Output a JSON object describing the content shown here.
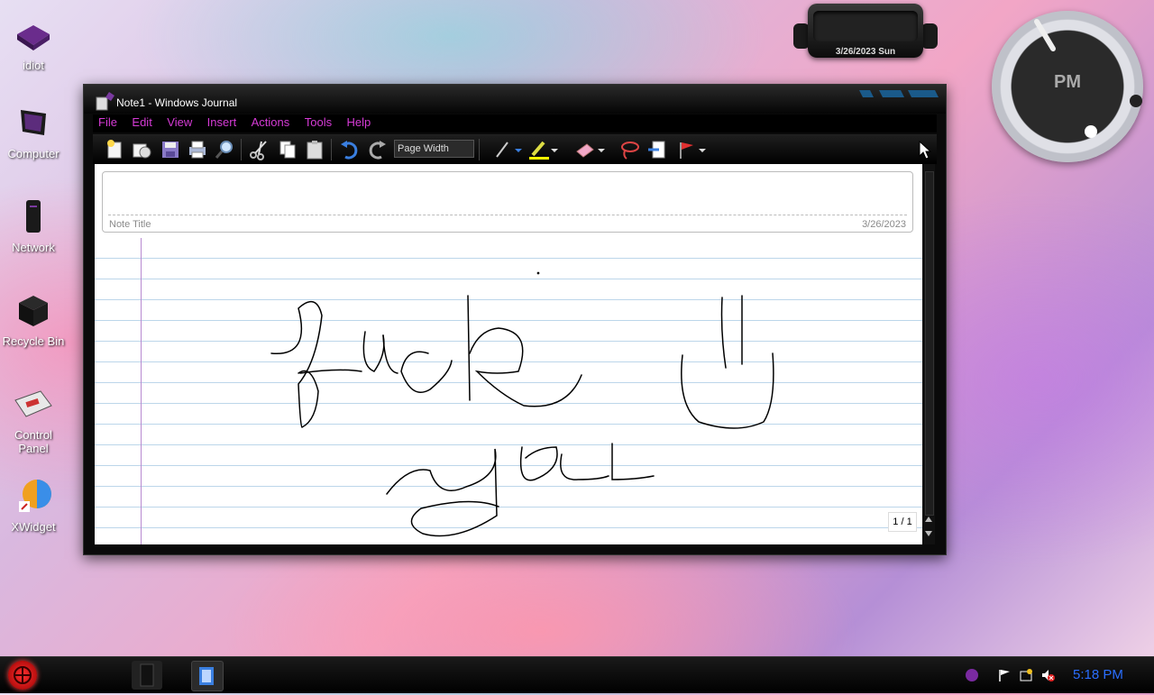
{
  "desktop_icons": [
    {
      "label": "idiot",
      "icon": "purple-box-icon"
    },
    {
      "label": "Computer",
      "icon": "computer-icon"
    },
    {
      "label": "Network",
      "icon": "network-icon"
    },
    {
      "label": "Recycle Bin",
      "icon": "recycle-bin-icon"
    },
    {
      "label": "Control Panel",
      "icon": "control-panel-icon"
    },
    {
      "label": "XWidget",
      "icon": "xwidget-icon"
    }
  ],
  "date_widget": {
    "text": "3/26/2023 Sun"
  },
  "clock_widget": {
    "period": "PM"
  },
  "window": {
    "title": "Note1 - Windows Journal",
    "menu": [
      "File",
      "Edit",
      "View",
      "Insert",
      "Actions",
      "Tools",
      "Help"
    ],
    "toolbar": {
      "zoom_value": "Page Width",
      "icons": [
        "new-note-icon",
        "new-note-template-icon",
        "save-icon",
        "print-icon",
        "find-icon",
        "cut-icon",
        "copy-icon",
        "paste-icon",
        "undo-icon",
        "redo-icon",
        "pen-icon",
        "highlighter-icon",
        "eraser-icon",
        "lasso-icon",
        "insert-space-icon",
        "flag-icon"
      ]
    },
    "note": {
      "title_label": "Note Title",
      "date": "3/26/2023",
      "page_indicator": "1 / 1",
      "ink_text": "fuck U you"
    }
  },
  "taskbar": {
    "time": "5:18 PM",
    "tray_icons": [
      "action-center-flag-icon",
      "network-tray-icon",
      "volume-muted-icon"
    ]
  },
  "colors": {
    "menu_text": "#d63bd6",
    "clock_text": "#2a6eff",
    "accent": "#ff3030"
  }
}
